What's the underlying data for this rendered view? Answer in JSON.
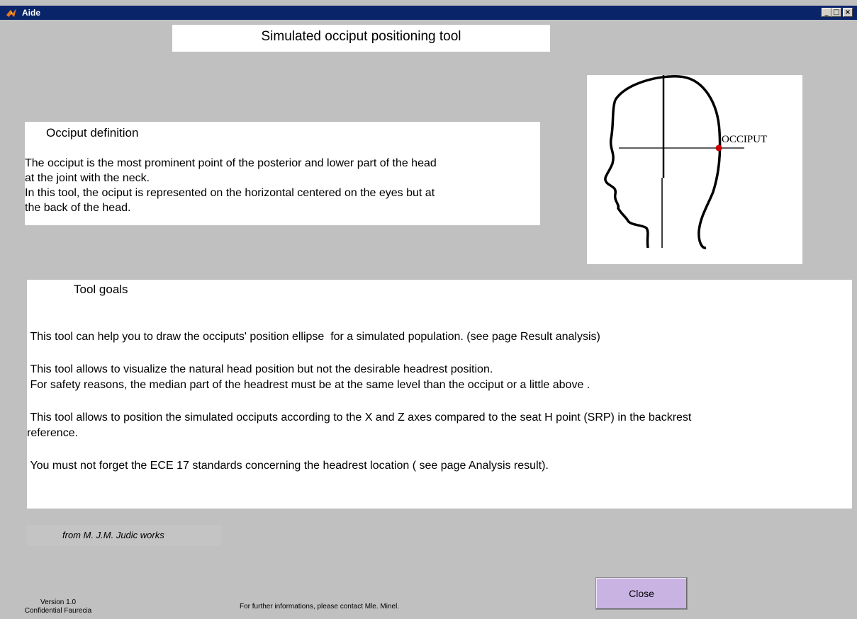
{
  "window": {
    "title": "Aide",
    "controls": {
      "minimize": "_",
      "maximize": "□",
      "close": "×"
    },
    "icon": "matlab-icon"
  },
  "page_title": "Simulated occiput positioning tool",
  "occiput_definition": {
    "heading": "Occiput definition",
    "line1": "The occiput is the most prominent point of the posterior and lower part of the head",
    "line2": "at the joint with the neck.",
    "line3": "In this tool, the ociput is represented on the horizontal centered on the eyes but at",
    "line4": "the back of the head."
  },
  "figure": {
    "label": "OCCIPUT",
    "marker_color": "#cc0000"
  },
  "tool_goals": {
    "heading": "Tool goals",
    "p1": " This tool can help you to draw the occiputs' position ellipse  for a simulated population. (see page Result analysis)",
    "p2a": " This tool allows to visualize the natural head position but not the desirable headrest position.",
    "p2b": " For safety reasons, the median part of the headrest must be at the same level than the occiput or a little above .",
    "p3a": " This tool allows to position the simulated occiputs according to the X and Z axes compared to the seat H point (SRP) in the backrest",
    "p3b": "reference.",
    "p4": " You must not forget the ECE 17 standards concerning the headrest location ( see page Analysis result)."
  },
  "credit": "from  M. J.M. Judic works",
  "version": {
    "line1": "Version 1.0",
    "line2": "Confidential Faurecia"
  },
  "contact": "For further informations, please contact Mle. Minel.",
  "close_button": "Close",
  "colors": {
    "background": "#c0c0c0",
    "titlebar": "#0a246a",
    "close_button": "#c9b3e3"
  }
}
